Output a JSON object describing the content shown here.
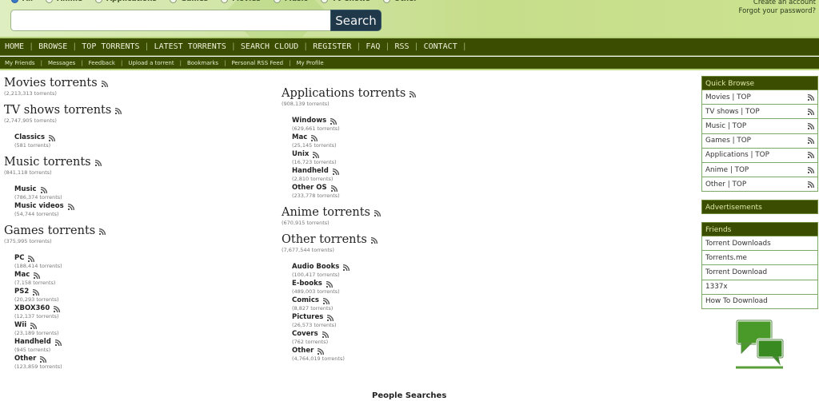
{
  "search": {
    "filters": [
      {
        "label": "All",
        "checked": true
      },
      {
        "label": "Anime",
        "checked": false
      },
      {
        "label": "Applications",
        "checked": false
      },
      {
        "label": "Games",
        "checked": false
      },
      {
        "label": "Movies",
        "checked": false
      },
      {
        "label": "Music",
        "checked": false
      },
      {
        "label": "TV shows",
        "checked": false
      },
      {
        "label": "Other",
        "checked": false
      }
    ],
    "value": "",
    "button_label": "Search"
  },
  "account": {
    "create": "Create an account",
    "forgot": "Forgot your password?"
  },
  "nav": [
    "HOME",
    "BROWSE",
    "TOP TORRENTS",
    "LATEST TORRENTS",
    "SEARCH CLOUD",
    "REGISTER",
    "FAQ",
    "RSS",
    "CONTACT"
  ],
  "subnav": [
    "My Friends",
    "Messages",
    "Feedback",
    "Upload a torrent",
    "Bookmarks",
    "Personal RSS Feed",
    "My Profile"
  ],
  "left_column": [
    {
      "title": "Movies torrents",
      "count": "(2,213,313 torrents)",
      "subs": []
    },
    {
      "title": "TV shows torrents",
      "count": "(2,747,905 torrents)",
      "subs": [
        {
          "name": "Classics",
          "count": "(581 torrents)"
        }
      ]
    },
    {
      "title": "Music torrents",
      "count": "(841,118 torrents)",
      "subs": [
        {
          "name": "Music",
          "count": "(786,374 torrents)"
        },
        {
          "name": "Music videos",
          "count": "(54,744 torrents)"
        }
      ]
    },
    {
      "title": "Games torrents",
      "count": "(375,995 torrents)",
      "subs": [
        {
          "name": "PC",
          "count": "(188,414 torrents)"
        },
        {
          "name": "Mac",
          "count": "(7,158 torrents)"
        },
        {
          "name": "PS2",
          "count": "(20,293 torrents)"
        },
        {
          "name": "XBOX360",
          "count": "(12,137 torrents)"
        },
        {
          "name": "Wii",
          "count": "(23,189 torrents)"
        },
        {
          "name": "Handheld",
          "count": "(945 torrents)"
        },
        {
          "name": "Other",
          "count": "(123,859 torrents)"
        }
      ]
    }
  ],
  "middle_column": [
    {
      "title": "Applications torrents",
      "count": "(908,139 torrents)",
      "subs": [
        {
          "name": "Windows",
          "count": "(629,661 torrents)"
        },
        {
          "name": "Mac",
          "count": "(25,145 torrents)"
        },
        {
          "name": "Unix",
          "count": "(16,723 torrents)"
        },
        {
          "name": "Handheld",
          "count": "(2,810 torrents)"
        },
        {
          "name": "Other OS",
          "count": "(233,778 torrents)"
        }
      ]
    },
    {
      "title": "Anime torrents",
      "count": "(670,915 torrents)",
      "subs": []
    },
    {
      "title": "Other torrents",
      "count": "(7,677,544 torrents)",
      "subs": [
        {
          "name": "Audio Books",
          "count": "(100,417 torrents)"
        },
        {
          "name": "E-books",
          "count": "(489,003 torrents)"
        },
        {
          "name": "Comics",
          "count": "(8,827 torrents)"
        },
        {
          "name": "Pictures",
          "count": "(26,573 torrents)"
        },
        {
          "name": "Covers",
          "count": "(762 torrents)"
        },
        {
          "name": "Other",
          "count": "(4,764,019 torrents)"
        }
      ]
    }
  ],
  "quick_browse": {
    "title": "Quick Browse",
    "items": [
      "Movies | TOP",
      "TV shows | TOP",
      "Music | TOP",
      "Games | TOP",
      "Applications | TOP",
      "Anime | TOP",
      "Other | TOP"
    ]
  },
  "advertisements": {
    "title": "Advertisements"
  },
  "friends": {
    "title": "Friends",
    "items": [
      "Torrent Downloads",
      "Torrents.me",
      "Torrent Download",
      "1337x",
      "How To Download"
    ]
  },
  "people_searches": "People Searches",
  "icons": {
    "rss": "rss-icon",
    "chat": "chat-bubbles-icon"
  },
  "colors": {
    "nav_bg": "#3a4d00",
    "header_green": "#c6dd8a",
    "search_button": "#20394a",
    "sidebar_border": "#7ea866"
  }
}
